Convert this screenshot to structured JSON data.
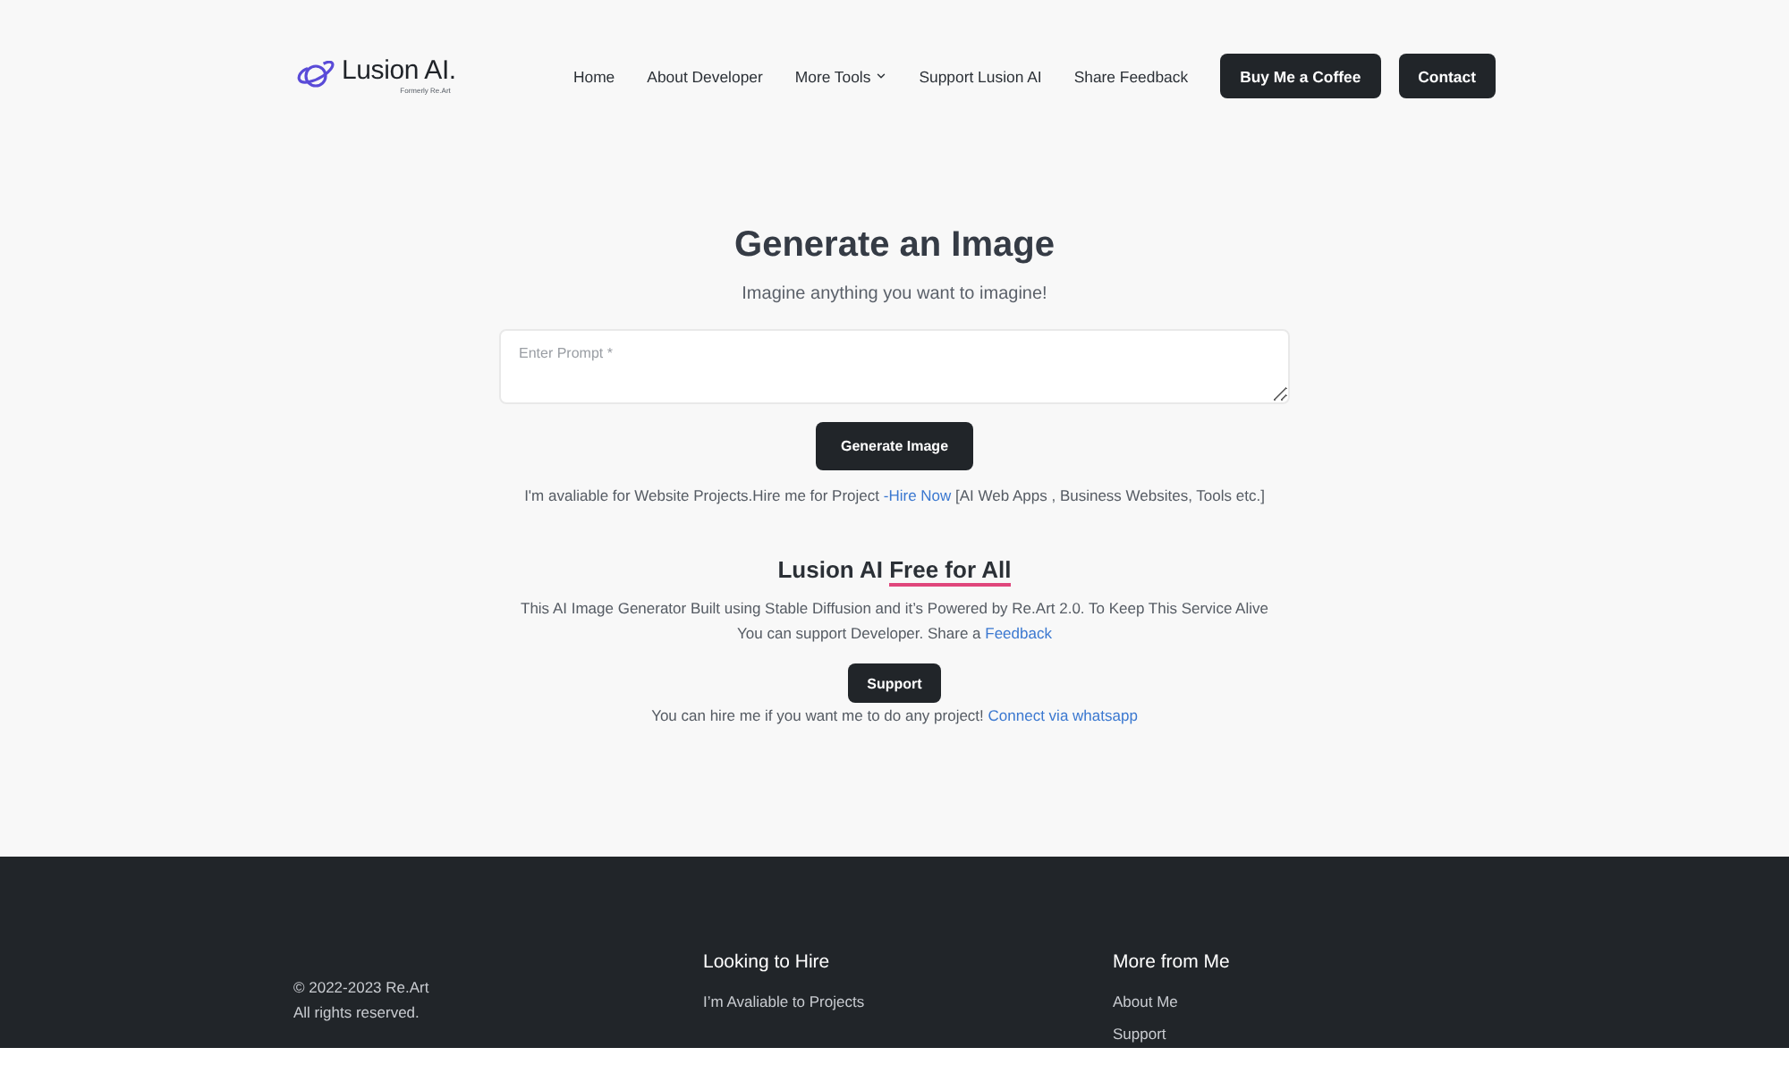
{
  "header": {
    "logo": {
      "name": "Lusion AI.",
      "tagline": "Formerly Re.Art"
    },
    "nav": [
      {
        "label": "Home",
        "kind": "link"
      },
      {
        "label": "About Developer",
        "kind": "link"
      },
      {
        "label": "More Tools",
        "kind": "dropdown"
      },
      {
        "label": "Support Lusion AI",
        "kind": "link"
      },
      {
        "label": "Share Feedback",
        "kind": "link"
      },
      {
        "label": "Buy Me a Coffee",
        "kind": "button"
      },
      {
        "label": "Contact",
        "kind": "button"
      }
    ]
  },
  "generator": {
    "title": "Generate an Image",
    "subtitle": "Imagine anything you want to imagine!",
    "prompt": {
      "placeholder": "Enter Prompt *"
    },
    "button": "Generate Image",
    "hire_note": {
      "before": "I'm avaliable for Website Projects.Hire me for Project ",
      "link": "-Hire Now",
      "after": " [AI Web Apps , Business Websites, Tools etc.]"
    }
  },
  "free_section": {
    "title": {
      "text": "Lusion AI",
      "highlight": "Free for All"
    },
    "description": {
      "text": "This AI Image Generator Built using Stable Diffusion and it’s Powered by Re.Art 2.0. To Keep This Service Alive You can support Developer. Share a ",
      "link": "Feedback"
    },
    "button": "Support",
    "contact_note": {
      "text": "You can hire me if you want me to do any project! ",
      "link": "Connect via whatsapp"
    }
  },
  "footer": {
    "copyright": [
      "© 2022-2023 Re.Art",
      "All rights reserved."
    ],
    "columns": [
      {
        "heading": "Looking to Hire",
        "links": [
          "I’m Avaliable to Projects"
        ]
      },
      {
        "heading": "More from Me",
        "links": [
          "About Me",
          "Support"
        ]
      }
    ]
  }
}
